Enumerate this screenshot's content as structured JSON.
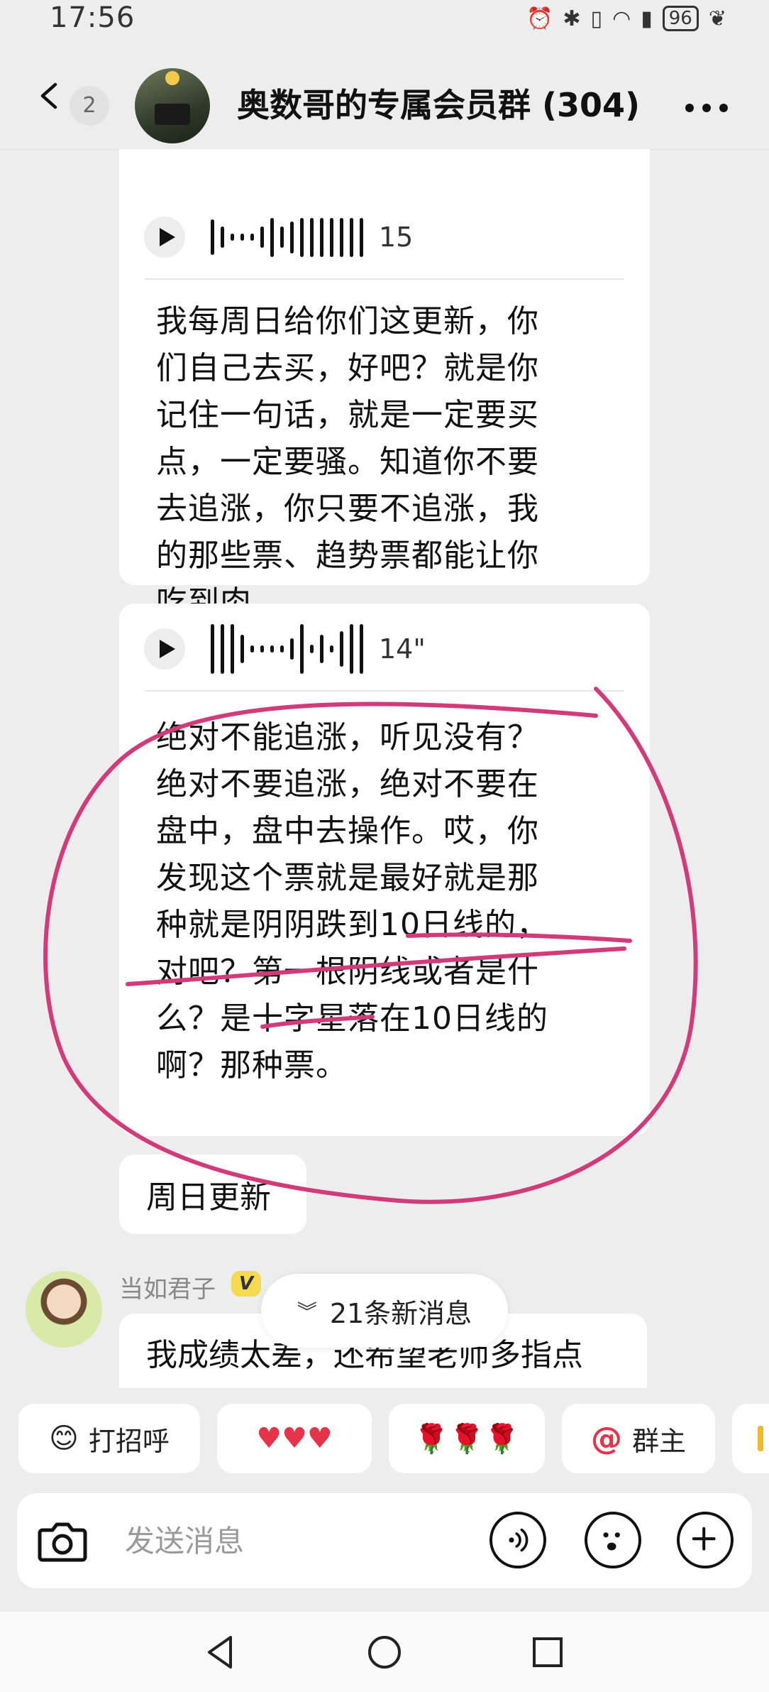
{
  "status": {
    "time": "17:56",
    "battery": "96"
  },
  "header": {
    "back_badge": "2",
    "title": "奥数哥的专属会员群 (304)"
  },
  "messages": [
    {
      "voice_duration": "15",
      "text_lines": [
        "我每周日给你们这更新，你",
        "们自己去买，好吧？就是你",
        "记住一句话，就是一定要买",
        "点，一定要骚。知道你不要",
        "去追涨，你只要不追涨，我",
        "的那些票、趋势票都能让你",
        "吃到肉。"
      ]
    },
    {
      "voice_duration": "14\"",
      "text_lines": [
        "绝对不能追涨，听见没有？",
        "绝对不要追涨，绝对不要在",
        "盘中，盘中去操作。哎，你",
        "发现这个票就是最好就是那",
        "种就是阴阴跌到10日线的，",
        "对吧？第一根阴线或者是什",
        "么？是十字星落在10日线的",
        "啊？那种票。"
      ]
    },
    {
      "text": "周日更新"
    },
    {
      "sender": "当如君子",
      "badge": "V",
      "text": "我成绩太差，还希望老师多指点"
    }
  ],
  "new_messages": "21条新消息",
  "quick_replies": {
    "hello": "打招呼",
    "hearts": "♥♥♥",
    "roses": "🌹🌹🌹",
    "at_owner": "群主"
  },
  "input": {
    "placeholder": "发送消息"
  },
  "colors": {
    "annotation": "#d13b7a",
    "background": "#ededed"
  }
}
